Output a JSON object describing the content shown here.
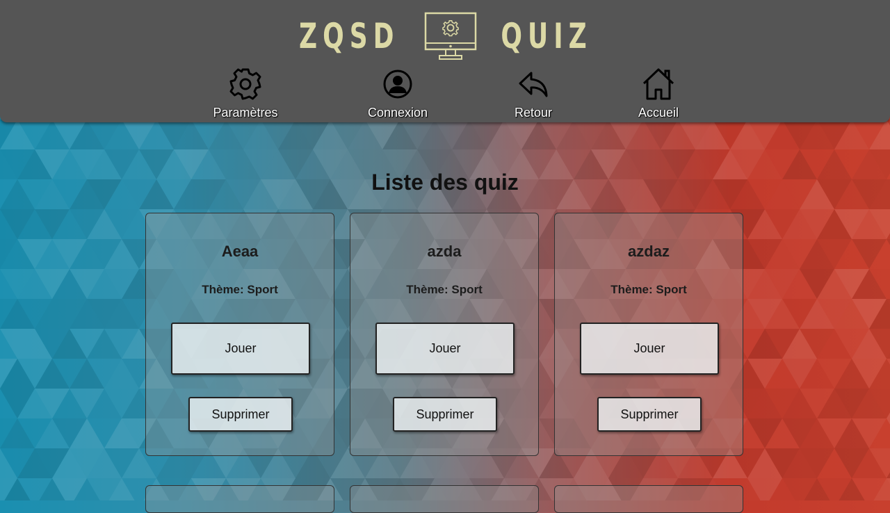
{
  "header": {
    "logo_left": "ZQSD",
    "logo_right": "QUIZ",
    "logo_icon": "monitor-gear-icon",
    "logo_color": "#dcd9a6",
    "background": "#555555"
  },
  "nav": {
    "items": [
      {
        "label": "Paramètres",
        "icon": "gear-icon"
      },
      {
        "label": "Connexion",
        "icon": "user-circle-icon"
      },
      {
        "label": "Retour",
        "icon": "reply-arrow-icon"
      },
      {
        "label": "Accueil",
        "icon": "home-icon"
      }
    ]
  },
  "main": {
    "title": "Liste des quiz",
    "quizzes": [
      {
        "name": "Aeaa",
        "theme": "Thème: Sport",
        "play_label": "Jouer",
        "delete_label": "Supprimer"
      },
      {
        "name": "azda",
        "theme": "Thème: Sport",
        "play_label": "Jouer",
        "delete_label": "Supprimer"
      },
      {
        "name": "azdaz",
        "theme": "Thème: Sport",
        "play_label": "Jouer",
        "delete_label": "Supprimer"
      }
    ]
  },
  "colors": {
    "background_left": "#1a8fb0",
    "background_right": "#c8402e"
  }
}
